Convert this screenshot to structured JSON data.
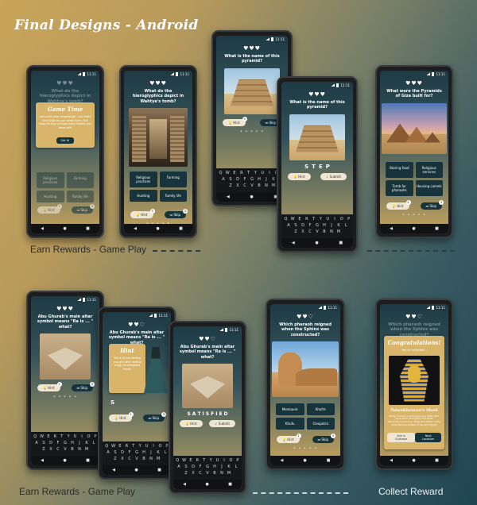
{
  "title": "Final Designs - Android",
  "captions": {
    "game_play_top": "Earn Rewards - Game Play",
    "game_play_bottom": "Earn Rewards - Game Play",
    "collect_reward": "Collect Reward"
  },
  "status_time": "11:11",
  "hearts": "♥♥♥",
  "hearts_two": "♥♥♡",
  "labels": {
    "hint": "Hint",
    "skip": "Skip",
    "submit": "Submit",
    "dots": "• • • • •"
  },
  "questions": {
    "hieroglyphs": "What do the hieroglyphics depict in Wahtye's tomb?",
    "pyramid_name": "What is the name of this pyramid?",
    "giza_built": "What were the Pyramids of Giza built for?",
    "altar": "Abu Ghurab's main altar symbol means \"Ra is ... \" what?",
    "sphinx": "Which pharaoh reigned when the Sphinx was constructed?"
  },
  "answers": {
    "hieroglyphs": [
      "Religious practices",
      "Farming",
      "Hunting",
      "Family life"
    ],
    "giza": [
      "Storing food",
      "Religious services",
      "Tomb for pharaohs",
      "Housing camels"
    ],
    "sphinx": [
      "Menkaure",
      "Khafre",
      "Khufu",
      "Cleopatra"
    ]
  },
  "game_time": {
    "title": "Game Time",
    "text": "Let's test your knowledge - use hints and skips as you need them, but keep an eye on how many hearts you have left!",
    "button": "Got It!"
  },
  "hint_popup": {
    "title": "Hint",
    "text": "Think of the feeling you get after eating a big, scrumptious meal!"
  },
  "letters": {
    "step": [
      "S",
      "T",
      "E",
      "P"
    ],
    "satisfied": [
      "S",
      "A",
      "T",
      "I",
      "S",
      "F",
      "I",
      "E",
      "D"
    ],
    "s": [
      "S"
    ]
  },
  "keyboard": [
    [
      "Q",
      "W",
      "E",
      "R",
      "T",
      "Y",
      "U",
      "I",
      "O",
      "P"
    ],
    [
      "A",
      "S",
      "D",
      "F",
      "G",
      "H",
      "J",
      "K",
      "L"
    ],
    [
      "Z",
      "X",
      "C",
      "V",
      "B",
      "N",
      "M"
    ]
  ],
  "reward": {
    "congrats": "Congratulations!",
    "collected": "You've collected...",
    "item": "Tutankhamun's Mask",
    "desc": "Made of 11kg of solid gold and inlaid with lapis lazuli, this glass and other semiprecious stones. 'King Tut's Mask' is the most famous artifact of ancient Egypt.",
    "btn_left": "See in Suitcase",
    "btn_right": "Next Location"
  },
  "nav": [
    "◀",
    "●",
    "■"
  ]
}
